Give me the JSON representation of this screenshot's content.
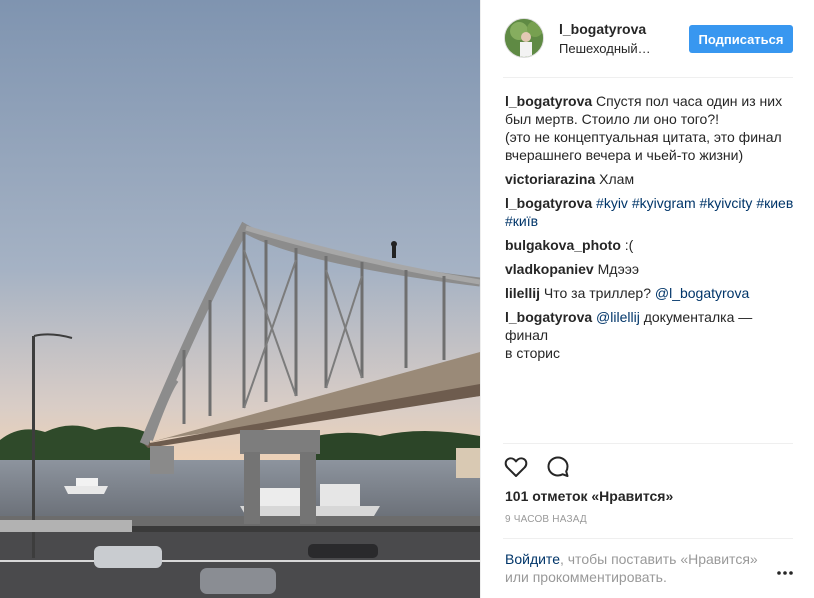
{
  "header": {
    "username": "l_bogatyrova",
    "location": "Пешеходный М...",
    "follow_label": "Подписаться"
  },
  "comments": [
    {
      "author": "l_bogatyrova",
      "lines": [
        "Спустя пол часа один из них",
        "был мертв. Стоило ли оно того?!",
        "(это не концептуальная цитата, это финал",
        "вчерашнего вечера и чьей-то жизни)"
      ]
    },
    {
      "author": "victoriarazina",
      "text": "Хлам"
    },
    {
      "author": "l_bogatyrova",
      "tags": [
        "#kyiv",
        "#kyivgram",
        "#kyivcity",
        "#киев",
        "#київ"
      ]
    },
    {
      "author": "bulgakova_photo",
      "text": ":("
    },
    {
      "author": "vladkopaniev",
      "text": "Мдэээ"
    },
    {
      "author": "lilellij",
      "text": "Что за триллер?",
      "mention": "@l_bogatyrova"
    },
    {
      "author": "l_bogatyrova",
      "mention": "@lilellij",
      "text_line1": "документалка — финал",
      "text_line2": "в сторис"
    }
  ],
  "likes": "101 отметок «Нравится»",
  "time": "9 ЧАСОВ НАЗАД",
  "login": {
    "link": "Войдите",
    "rest_line1": ", чтобы поставить «Нравится»",
    "rest_line2": "или прокомментировать."
  },
  "icons": {
    "like": "heart-icon",
    "comment": "speech-bubble-icon",
    "more": "more-options-icon"
  },
  "colors": {
    "accent": "#3897f0",
    "link": "#003569",
    "muted": "#999999"
  }
}
